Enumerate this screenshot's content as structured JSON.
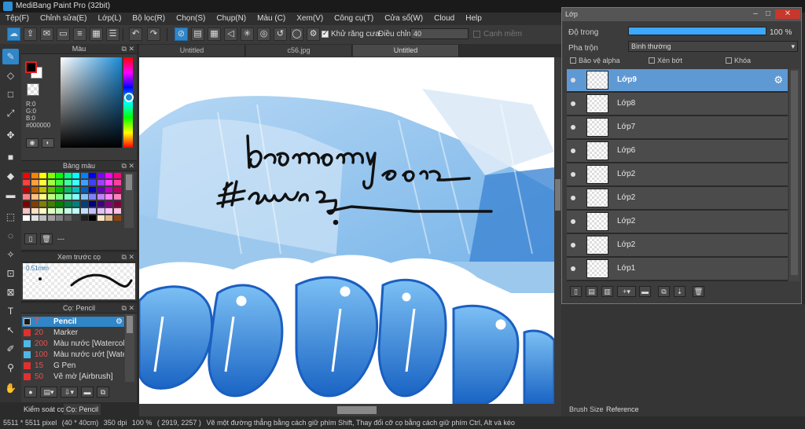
{
  "window": {
    "title": "MediBang Paint Pro (32bit)"
  },
  "menu": [
    "Tệp(F)",
    "Chỉnh sửa(E)",
    "Lớp(L)",
    "Bộ lọc(R)",
    "Chọn(S)",
    "Chụp(N)",
    "Màu (C)",
    "Xem(V)",
    "Công cụ(T)",
    "Cửa sổ(W)",
    "Cloud",
    "Help"
  ],
  "toolbar": {
    "antialias_label": "Khử răng cưa",
    "adjust_label": "Điều chỉnh",
    "adjust_value": "40",
    "mask_label": "Cạnh mềm"
  },
  "color_panel": {
    "title": "Màu",
    "r": "R:0",
    "g": "G:0",
    "b": "B:0",
    "hex": "#000000",
    "fg_color": "#000000",
    "bg_color": "#ffffff",
    "hue_color": "#1b8ad6"
  },
  "palette_panel": {
    "title": "Bảng màu",
    "name": "---",
    "colors": [
      "#ff0000",
      "#ff8000",
      "#ffff00",
      "#80ff00",
      "#00ff00",
      "#00ff80",
      "#00ffff",
      "#0080ff",
      "#0000ff",
      "#8000ff",
      "#ff00ff",
      "#ff0080",
      "#ff4040",
      "#ff9f40",
      "#ffff40",
      "#9fff40",
      "#40ff40",
      "#40ff9f",
      "#40ffff",
      "#409fff",
      "#4040ff",
      "#9f40ff",
      "#ff40ff",
      "#ff409f",
      "#c00000",
      "#c06000",
      "#c0c000",
      "#60c000",
      "#00c000",
      "#00c060",
      "#00c0c0",
      "#0060c0",
      "#0000c0",
      "#6000c0",
      "#c000c0",
      "#c00060",
      "#ff8080",
      "#ffc080",
      "#ffff80",
      "#c0ff80",
      "#80ff80",
      "#80ffc0",
      "#80ffff",
      "#80c0ff",
      "#8080ff",
      "#c080ff",
      "#ff80ff",
      "#ff80c0",
      "#800000",
      "#804000",
      "#808000",
      "#408000",
      "#008000",
      "#008040",
      "#008080",
      "#004080",
      "#000080",
      "#400080",
      "#800080",
      "#800040",
      "#ffc0c0",
      "#ffe0c0",
      "#ffffc0",
      "#e0ffc0",
      "#c0ffc0",
      "#c0ffe0",
      "#c0ffff",
      "#c0e0ff",
      "#c0c0ff",
      "#e0c0ff",
      "#ffc0ff",
      "#ffc0e0",
      "#ffffff",
      "#e0e0e0",
      "#c0c0c0",
      "#a0a0a0",
      "#808080",
      "#606060",
      "#404040",
      "#202020",
      "#000000",
      "#ffe4c4",
      "#deb887",
      "#8b4513"
    ]
  },
  "preview_panel": {
    "title": "Xem trước cọ",
    "size": "0.51mm"
  },
  "brush_panel": {
    "title": "Cọ: Pencil",
    "items": [
      {
        "size": "7",
        "name": "Pencil",
        "color": "#1a1a1a"
      },
      {
        "size": "20",
        "name": "Marker",
        "color": "#e03030"
      },
      {
        "size": "200",
        "name": "Màu nước [Watercolor]",
        "color": "#4fb8e8"
      },
      {
        "size": "100",
        "name": "Màu nước ướt [Watercolor Wet]",
        "color": "#4fb8e8"
      },
      {
        "size": "15",
        "name": "G Pen",
        "color": "#e03030"
      },
      {
        "size": "50",
        "name": "Vẽ mờ [Airbrush]",
        "color": "#e03030"
      }
    ]
  },
  "bottom_tabs": [
    "Kiểm soát cọ",
    "Cọ: Pencil"
  ],
  "doc_tabs": [
    "Untitled",
    "c56.jpg",
    "Untitled"
  ],
  "canvas": {
    "handwriting_line1": "bmomy 1002",
    "handwriting_line2": "#auuaz"
  },
  "status": {
    "size": "5511 * 5511 pixel",
    "cm": "(40 * 40cm)",
    "dpi": "350 dpi",
    "zoom": "100 %",
    "coords": "( 2919, 2257 )",
    "hint": "Vẽ một đường thẳng bằng cách giữ phím Shift, Thay đổi cỡ cọ bằng cách giữ phím Ctrl, Alt và kéo"
  },
  "layer_window": {
    "title": "Lớp",
    "opacity_label": "Độ trong",
    "opacity_value": "100 %",
    "opacity": 1.0,
    "blend_label": "Pha trộn",
    "blend_value": "Bình thường",
    "protect_alpha": "Bảo vệ alpha",
    "clipping": "Xén bớt",
    "lock": "Khóa",
    "layers": [
      "Lớp9",
      "Lớp8",
      "Lớp7",
      "Lớp6",
      "Lớp2",
      "Lớp2",
      "Lớp2",
      "Lớp2",
      "Lớp1"
    ]
  },
  "right_dock": {
    "tab1": "Brush Size",
    "tab2": "Reference"
  }
}
